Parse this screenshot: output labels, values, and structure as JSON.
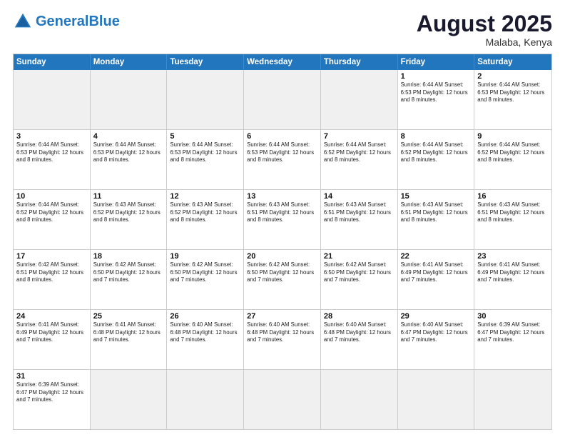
{
  "header": {
    "logo_general": "General",
    "logo_blue": "Blue",
    "month_title": "August 2025",
    "location": "Malaba, Kenya"
  },
  "days_of_week": [
    "Sunday",
    "Monday",
    "Tuesday",
    "Wednesday",
    "Thursday",
    "Friday",
    "Saturday"
  ],
  "weeks": [
    [
      {
        "day": "",
        "info": "",
        "empty": true
      },
      {
        "day": "",
        "info": "",
        "empty": true
      },
      {
        "day": "",
        "info": "",
        "empty": true
      },
      {
        "day": "",
        "info": "",
        "empty": true
      },
      {
        "day": "",
        "info": "",
        "empty": true
      },
      {
        "day": "1",
        "info": "Sunrise: 6:44 AM\nSunset: 6:53 PM\nDaylight: 12 hours\nand 8 minutes."
      },
      {
        "day": "2",
        "info": "Sunrise: 6:44 AM\nSunset: 6:53 PM\nDaylight: 12 hours\nand 8 minutes."
      }
    ],
    [
      {
        "day": "3",
        "info": "Sunrise: 6:44 AM\nSunset: 6:53 PM\nDaylight: 12 hours\nand 8 minutes."
      },
      {
        "day": "4",
        "info": "Sunrise: 6:44 AM\nSunset: 6:53 PM\nDaylight: 12 hours\nand 8 minutes."
      },
      {
        "day": "5",
        "info": "Sunrise: 6:44 AM\nSunset: 6:53 PM\nDaylight: 12 hours\nand 8 minutes."
      },
      {
        "day": "6",
        "info": "Sunrise: 6:44 AM\nSunset: 6:53 PM\nDaylight: 12 hours\nand 8 minutes."
      },
      {
        "day": "7",
        "info": "Sunrise: 6:44 AM\nSunset: 6:52 PM\nDaylight: 12 hours\nand 8 minutes."
      },
      {
        "day": "8",
        "info": "Sunrise: 6:44 AM\nSunset: 6:52 PM\nDaylight: 12 hours\nand 8 minutes."
      },
      {
        "day": "9",
        "info": "Sunrise: 6:44 AM\nSunset: 6:52 PM\nDaylight: 12 hours\nand 8 minutes."
      }
    ],
    [
      {
        "day": "10",
        "info": "Sunrise: 6:44 AM\nSunset: 6:52 PM\nDaylight: 12 hours\nand 8 minutes."
      },
      {
        "day": "11",
        "info": "Sunrise: 6:43 AM\nSunset: 6:52 PM\nDaylight: 12 hours\nand 8 minutes."
      },
      {
        "day": "12",
        "info": "Sunrise: 6:43 AM\nSunset: 6:52 PM\nDaylight: 12 hours\nand 8 minutes."
      },
      {
        "day": "13",
        "info": "Sunrise: 6:43 AM\nSunset: 6:51 PM\nDaylight: 12 hours\nand 8 minutes."
      },
      {
        "day": "14",
        "info": "Sunrise: 6:43 AM\nSunset: 6:51 PM\nDaylight: 12 hours\nand 8 minutes."
      },
      {
        "day": "15",
        "info": "Sunrise: 6:43 AM\nSunset: 6:51 PM\nDaylight: 12 hours\nand 8 minutes."
      },
      {
        "day": "16",
        "info": "Sunrise: 6:43 AM\nSunset: 6:51 PM\nDaylight: 12 hours\nand 8 minutes."
      }
    ],
    [
      {
        "day": "17",
        "info": "Sunrise: 6:42 AM\nSunset: 6:51 PM\nDaylight: 12 hours\nand 8 minutes."
      },
      {
        "day": "18",
        "info": "Sunrise: 6:42 AM\nSunset: 6:50 PM\nDaylight: 12 hours\nand 7 minutes."
      },
      {
        "day": "19",
        "info": "Sunrise: 6:42 AM\nSunset: 6:50 PM\nDaylight: 12 hours\nand 7 minutes."
      },
      {
        "day": "20",
        "info": "Sunrise: 6:42 AM\nSunset: 6:50 PM\nDaylight: 12 hours\nand 7 minutes."
      },
      {
        "day": "21",
        "info": "Sunrise: 6:42 AM\nSunset: 6:50 PM\nDaylight: 12 hours\nand 7 minutes."
      },
      {
        "day": "22",
        "info": "Sunrise: 6:41 AM\nSunset: 6:49 PM\nDaylight: 12 hours\nand 7 minutes."
      },
      {
        "day": "23",
        "info": "Sunrise: 6:41 AM\nSunset: 6:49 PM\nDaylight: 12 hours\nand 7 minutes."
      }
    ],
    [
      {
        "day": "24",
        "info": "Sunrise: 6:41 AM\nSunset: 6:49 PM\nDaylight: 12 hours\nand 7 minutes."
      },
      {
        "day": "25",
        "info": "Sunrise: 6:41 AM\nSunset: 6:48 PM\nDaylight: 12 hours\nand 7 minutes."
      },
      {
        "day": "26",
        "info": "Sunrise: 6:40 AM\nSunset: 6:48 PM\nDaylight: 12 hours\nand 7 minutes."
      },
      {
        "day": "27",
        "info": "Sunrise: 6:40 AM\nSunset: 6:48 PM\nDaylight: 12 hours\nand 7 minutes."
      },
      {
        "day": "28",
        "info": "Sunrise: 6:40 AM\nSunset: 6:48 PM\nDaylight: 12 hours\nand 7 minutes."
      },
      {
        "day": "29",
        "info": "Sunrise: 6:40 AM\nSunset: 6:47 PM\nDaylight: 12 hours\nand 7 minutes."
      },
      {
        "day": "30",
        "info": "Sunrise: 6:39 AM\nSunset: 6:47 PM\nDaylight: 12 hours\nand 7 minutes."
      }
    ],
    [
      {
        "day": "31",
        "info": "Sunrise: 6:39 AM\nSunset: 6:47 PM\nDaylight: 12 hours\nand 7 minutes."
      },
      {
        "day": "",
        "info": "",
        "empty": true
      },
      {
        "day": "",
        "info": "",
        "empty": true
      },
      {
        "day": "",
        "info": "",
        "empty": true
      },
      {
        "day": "",
        "info": "",
        "empty": true
      },
      {
        "day": "",
        "info": "",
        "empty": true
      },
      {
        "day": "",
        "info": "",
        "empty": true
      }
    ]
  ]
}
